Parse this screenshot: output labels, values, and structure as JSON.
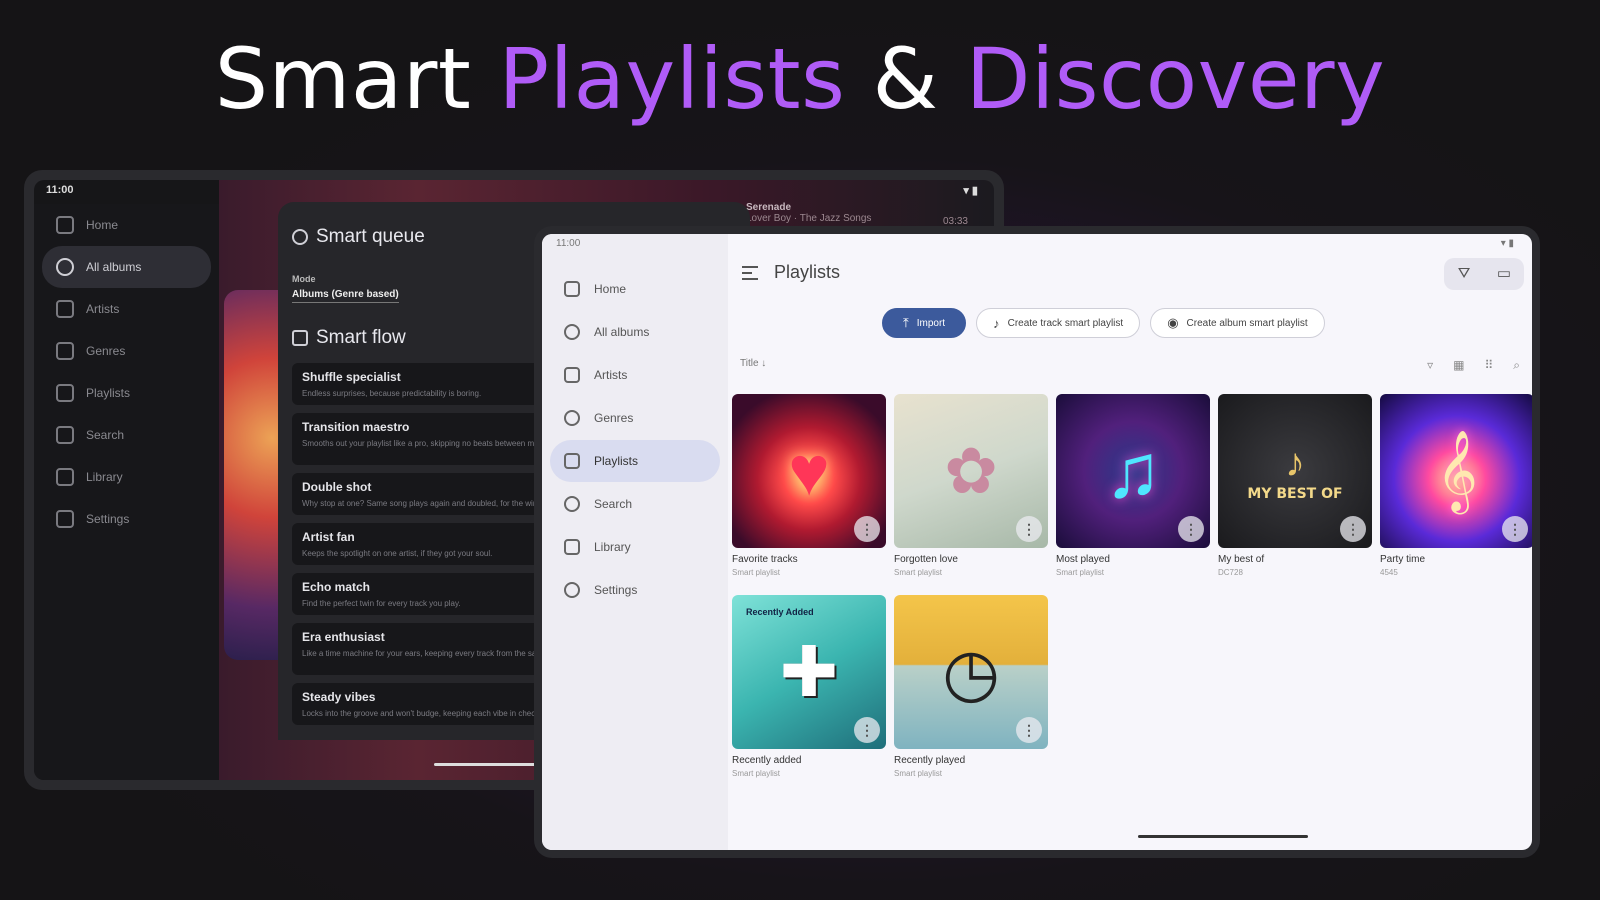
{
  "headline": {
    "part1": "Smart ",
    "part2": "Playlists",
    "part3": " & ",
    "part4": "Discovery"
  },
  "colors": {
    "accent": "#b05cf7",
    "primary_button": "#3c5a9c",
    "active_nav": "#d9dcf0"
  },
  "back_tablet": {
    "status_time": "11:00",
    "status_icons": "▾ ▮",
    "nav": [
      {
        "label": "Home",
        "icon": "home-icon"
      },
      {
        "label": "All albums",
        "icon": "album-icon"
      },
      {
        "label": "Artists",
        "icon": "artists-icon"
      },
      {
        "label": "Genres",
        "icon": "genres-icon"
      },
      {
        "label": "Playlists",
        "icon": "playlists-icon"
      },
      {
        "label": "Search",
        "icon": "search-icon"
      },
      {
        "label": "Library",
        "icon": "library-icon"
      },
      {
        "label": "Settings",
        "icon": "settings-icon"
      }
    ],
    "now_playing": {
      "title": "Serenade",
      "subtitle": "Lover Boy · The Jazz Songs",
      "duration": "03:33"
    },
    "smart_queue": {
      "title": "Smart queue",
      "mode_label": "Mode",
      "mode_value": "Albums (Genre based)"
    },
    "smart_flow": {
      "title": "Smart flow",
      "items": [
        {
          "title": "Shuffle specialist",
          "desc": "Endless surprises, because predictability is boring."
        },
        {
          "title": "Transition maestro",
          "desc": "Smooths out your playlist like a pro, skipping no beats between mixed genres."
        },
        {
          "title": "Double shot",
          "desc": "Why stop at one? Same song plays again and doubled, for the win."
        },
        {
          "title": "Artist fan",
          "desc": "Keeps the spotlight on one artist, if they got your soul."
        },
        {
          "title": "Echo match",
          "desc": "Find the perfect twin for every track you play."
        },
        {
          "title": "Era enthusiast",
          "desc": "Like a time machine for your ears, keeping every track from the same time frame."
        },
        {
          "title": "Steady vibes",
          "desc": "Locks into the groove and won't budge, keeping each vibe in check."
        }
      ]
    }
  },
  "front_tablet": {
    "status_time": "11:00",
    "status_icons": "▾ ▮",
    "nav": [
      {
        "label": "Home",
        "icon": "home-icon"
      },
      {
        "label": "All albums",
        "icon": "album-icon"
      },
      {
        "label": "Artists",
        "icon": "artists-icon"
      },
      {
        "label": "Genres",
        "icon": "genres-icon"
      },
      {
        "label": "Playlists",
        "icon": "playlists-icon"
      },
      {
        "label": "Search",
        "icon": "search-icon"
      },
      {
        "label": "Library",
        "icon": "library-icon"
      },
      {
        "label": "Settings",
        "icon": "settings-icon"
      }
    ],
    "page_title": "Playlists",
    "buttons": {
      "import": "Import",
      "track_smart": "Create track smart playlist",
      "album_smart": "Create album smart playlist"
    },
    "sort_label": "Title ↓",
    "playlists": [
      {
        "name": "Favorite tracks",
        "sub": "Smart playlist"
      },
      {
        "name": "Forgotten love",
        "sub": "Smart playlist"
      },
      {
        "name": "Most played",
        "sub": "Smart playlist"
      },
      {
        "name": "My best of",
        "sub": "DC728"
      },
      {
        "name": "Party time",
        "sub": "4545"
      },
      {
        "name": "Recently added",
        "sub": "Smart playlist"
      },
      {
        "name": "Recently played",
        "sub": "Smart playlist"
      }
    ],
    "cover_texts": {
      "best_of": "MY BEST OF",
      "recently_added": "Recently Added"
    }
  }
}
